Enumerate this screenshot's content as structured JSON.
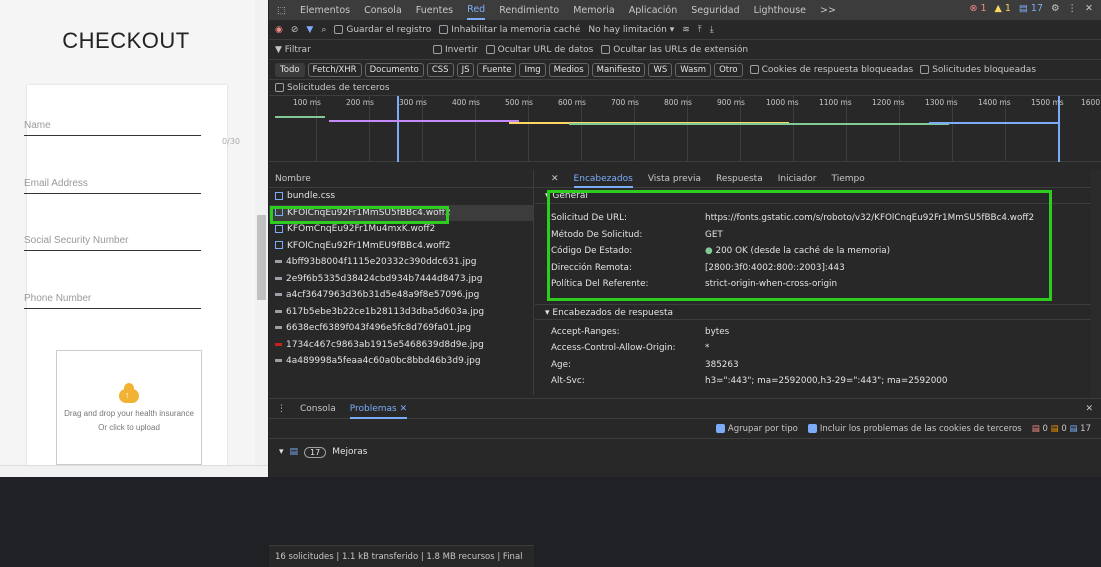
{
  "page": {
    "title": "CHECKOUT",
    "fields": [
      {
        "label": "Name",
        "counter": "0/30"
      },
      {
        "label": "Email Address"
      },
      {
        "label": "Social Security Number"
      },
      {
        "label": "Phone Number"
      }
    ],
    "upload": {
      "line1": "Drag and drop your health insurance",
      "line2": "Or click to upload"
    }
  },
  "devtools": {
    "tabs": [
      "Elementos",
      "Consola",
      "Fuentes",
      "Red",
      "Rendimiento",
      "Memoria",
      "Aplicación",
      "Seguridad",
      "Lighthouse",
      ">>"
    ],
    "active_tab": "Red",
    "badges": {
      "errors": "1",
      "warnings": "1",
      "info": "17"
    },
    "toolbar": {
      "preserve_log": "Guardar el registro",
      "disable_cache": "Inhabilitar la memoria caché",
      "throttling": "No hay limitación"
    },
    "filter": {
      "placeholder": "Filtrar",
      "invert": "Invertir",
      "hide_data_urls": "Ocultar URL de datos",
      "hide_extension_urls": "Ocultar las URLs de extensión"
    },
    "type_filters": [
      "Todo",
      "Fetch/XHR",
      "Documento",
      "CSS",
      "JS",
      "Fuente",
      "Img",
      "Medios",
      "Manifiesto",
      "WS",
      "Wasm",
      "Otro"
    ],
    "blocked_cookies": "Cookies de respuesta bloqueadas",
    "blocked_requests": "Solicitudes bloqueadas",
    "third_party": "Solicitudes de terceros",
    "ticks": [
      "100 ms",
      "200 ms",
      "300 ms",
      "400 ms",
      "500 ms",
      "600 ms",
      "700 ms",
      "800 ms",
      "900 ms",
      "1000 ms",
      "1100 ms",
      "1200 ms",
      "1300 ms",
      "1400 ms",
      "1500 ms",
      "1600"
    ],
    "name_header": "Nombre",
    "requests": [
      {
        "name": "bundle.css",
        "type": "css"
      },
      {
        "name": "KFOlCnqEu92Fr1MmSU5fBBc4.woff2",
        "type": "font"
      },
      {
        "name": "KFOmCnqEu92Fr1Mu4mxK.woff2",
        "type": "font"
      },
      {
        "name": "KFOlCnqEu92Fr1MmEU9fBBc4.woff2",
        "type": "font"
      },
      {
        "name": "4bff93b8004f1115e20332c390ddc631.jpg",
        "type": "img"
      },
      {
        "name": "2e9f6b5335d38424cbd934b7444d8473.jpg",
        "type": "img"
      },
      {
        "name": "a4cf3647963d36b31d5e48a9f8e57096.jpg",
        "type": "img"
      },
      {
        "name": "617b5ebe3b22ce1b28113d3dba5d603a.jpg",
        "type": "img"
      },
      {
        "name": "6638ecf6389f043f496e5fc8d769fa01.jpg",
        "type": "img"
      },
      {
        "name": "1734c467c9863ab1915e5468639d8d9e.jpg",
        "type": "img"
      },
      {
        "name": "4a489998a5feaa4c60a0bc8bbd46b3d9.jpg",
        "type": "img"
      }
    ],
    "summary": "16 solicitudes  |  1.1 kB transferido  |  1.8 MB recursos  |  Final",
    "detail_tabs": [
      "Encabezados",
      "Vista previa",
      "Respuesta",
      "Iniciador",
      "Tiempo"
    ],
    "general_title": "▾ General",
    "general": [
      {
        "k": "Solicitud De URL:",
        "v": "https://fonts.gstatic.com/s/roboto/v32/KFOlCnqEu92Fr1MmSU5fBBc4.woff2"
      },
      {
        "k": "Método De Solicitud:",
        "v": "GET"
      },
      {
        "k": "Código De Estado:",
        "v": "200 OK (desde la caché de la memoria)"
      },
      {
        "k": "Dirección Remota:",
        "v": "[2800:3f0:4002:800::2003]:443"
      },
      {
        "k": "Política Del Referente:",
        "v": "strict-origin-when-cross-origin"
      }
    ],
    "response_title": "▾ Encabezados de respuesta",
    "response_headers": [
      {
        "k": "Accept-Ranges:",
        "v": "bytes"
      },
      {
        "k": "Access-Control-Allow-Origin:",
        "v": "*"
      },
      {
        "k": "Age:",
        "v": "385263"
      },
      {
        "k": "Alt-Svc:",
        "v": "h3=\":443\"; ma=2592000,h3-29=\":443\"; ma=2592000"
      }
    ],
    "drawer": {
      "tabs": [
        "Consola",
        "Problemas"
      ],
      "group_by_type": "Agrupar por tipo",
      "include_third_party": "Incluir los problemas de las cookies de terceros",
      "counts": {
        "red": "0",
        "orange": "0",
        "blue": "17"
      },
      "improvements_count": "17",
      "improvements_label": "Mejoras"
    }
  }
}
